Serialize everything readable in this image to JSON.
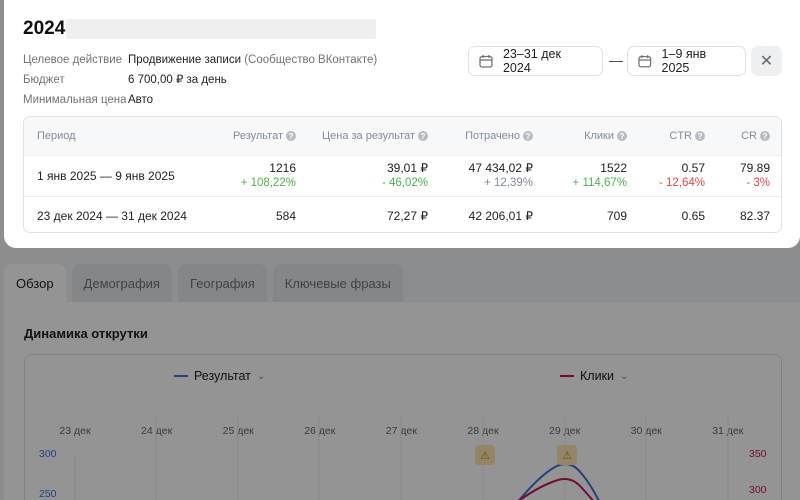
{
  "modal": {
    "year": "2024",
    "info": [
      {
        "label": "Целевое действие",
        "value": "Продвижение записи",
        "sub": "(Сообщество ВКонтакте)"
      },
      {
        "label": "Бюджет",
        "value": "6 700,00 ₽ за день",
        "sub": ""
      },
      {
        "label": "Минимальная цена",
        "value": "Авто",
        "sub": ""
      }
    ],
    "date_range_1": "23–31 дек 2024",
    "date_separator": "—",
    "date_range_2": "1–9 янв 2025",
    "close_glyph": "✕",
    "table": {
      "headers": [
        "Период",
        "Результат",
        "Цена за результат",
        "Потрачено",
        "Клики",
        "CTR",
        "CR"
      ],
      "help_glyph": "?",
      "rows": [
        {
          "period": "1 янв 2025 — 9 янв 2025",
          "values": [
            "1216",
            "39,01 ₽",
            "47 434,02 ₽",
            "1522",
            "0.57",
            "79.89"
          ],
          "deltas": [
            "+ 108,22%",
            "- 46,02%",
            "+ 12,39%",
            "+ 114,67%",
            "- 12,64%",
            "- 3%"
          ]
        },
        {
          "period": "23 дек 2024 — 31 дек 2024",
          "values": [
            "584",
            "72,27 ₽",
            "42 206,01 ₽",
            "709",
            "0.65",
            "82.37"
          ]
        }
      ]
    }
  },
  "tabs": [
    "Обзор",
    "Демография",
    "География",
    "Ключевые фразы"
  ],
  "dynamics": {
    "title": "Динамика открутки",
    "legend": [
      {
        "name": "Результат",
        "color": "#3f6fd8"
      },
      {
        "name": "Клики",
        "color": "#c2185b"
      }
    ],
    "caret": "⌄",
    "warning_glyph": "⚠"
  },
  "chart_data": {
    "type": "line",
    "x": [
      "23 дек",
      "24 дек",
      "25 дек",
      "26 дек",
      "27 дек",
      "28 дек",
      "29 дек",
      "30 дек",
      "31 дек"
    ],
    "y_left_ticks": [
      "300",
      "250"
    ],
    "y_right_ticks": [
      "350",
      "300"
    ],
    "series": [
      {
        "name": "Результат",
        "color": "#3f6fd8",
        "axis": "left"
      },
      {
        "name": "Клики",
        "color": "#c2185b",
        "axis": "right"
      }
    ],
    "warnings_at": [
      "28 дек",
      "29 дек"
    ]
  }
}
